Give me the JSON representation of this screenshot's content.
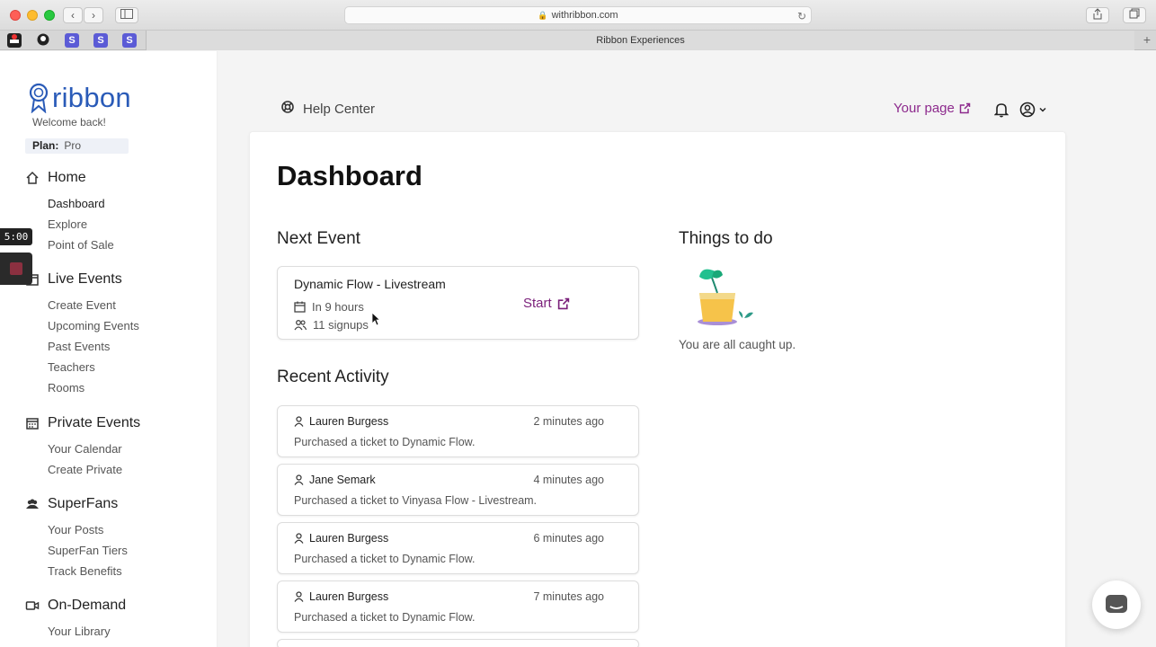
{
  "browser": {
    "url": "withribbon.com",
    "tab_title": "Ribbon Experiences",
    "bookmarks": [
      "incognito-icon",
      "github-icon",
      "S",
      "S",
      "S"
    ]
  },
  "brand": {
    "name": "ribbon",
    "welcome": "Welcome back!",
    "plan_label": "Plan:",
    "plan_value": "Pro"
  },
  "recording": {
    "timer": "5:00"
  },
  "sidebar": {
    "sections": [
      {
        "label": "Home",
        "icon": "home-icon",
        "items": [
          "Dashboard",
          "Explore",
          "Point of Sale"
        ]
      },
      {
        "label": "Live Events",
        "icon": "calendar-icon",
        "items": [
          "Create Event",
          "Upcoming Events",
          "Past Events",
          "Teachers",
          "Rooms"
        ]
      },
      {
        "label": "Private Events",
        "icon": "calendar-grid-icon",
        "items": [
          "Your Calendar",
          "Create Private"
        ]
      },
      {
        "label": "SuperFans",
        "icon": "group-icon",
        "items": [
          "Your Posts",
          "SuperFan Tiers",
          "Track Benefits"
        ]
      },
      {
        "label": "On-Demand",
        "icon": "video-icon",
        "items": [
          "Your Library"
        ]
      }
    ]
  },
  "header": {
    "help": "Help Center",
    "your_page": "Your page"
  },
  "dashboard": {
    "title": "Dashboard",
    "next_event_heading": "Next Event",
    "next_event": {
      "name": "Dynamic Flow - Livestream",
      "when": "In 9 hours",
      "signups": "11 signups",
      "action": "Start"
    },
    "todo_heading": "Things to do",
    "todo_empty": "You are all caught up.",
    "activity_heading": "Recent Activity",
    "activity": [
      {
        "user": "Lauren Burgess",
        "time": "2 minutes ago",
        "desc": "Purchased a ticket to Dynamic Flow."
      },
      {
        "user": "Jane Semark",
        "time": "4 minutes ago",
        "desc": "Purchased a ticket to Vinyasa Flow - Livestream."
      },
      {
        "user": "Lauren Burgess",
        "time": "6 minutes ago",
        "desc": "Purchased a ticket to Dynamic Flow."
      },
      {
        "user": "Lauren Burgess",
        "time": "7 minutes ago",
        "desc": "Purchased a ticket to Dynamic Flow."
      }
    ]
  },
  "colors": {
    "brand_blue": "#2a5bb8",
    "accent_purple": "#7a1f7a",
    "your_page_purple": "#8d2a8d"
  }
}
